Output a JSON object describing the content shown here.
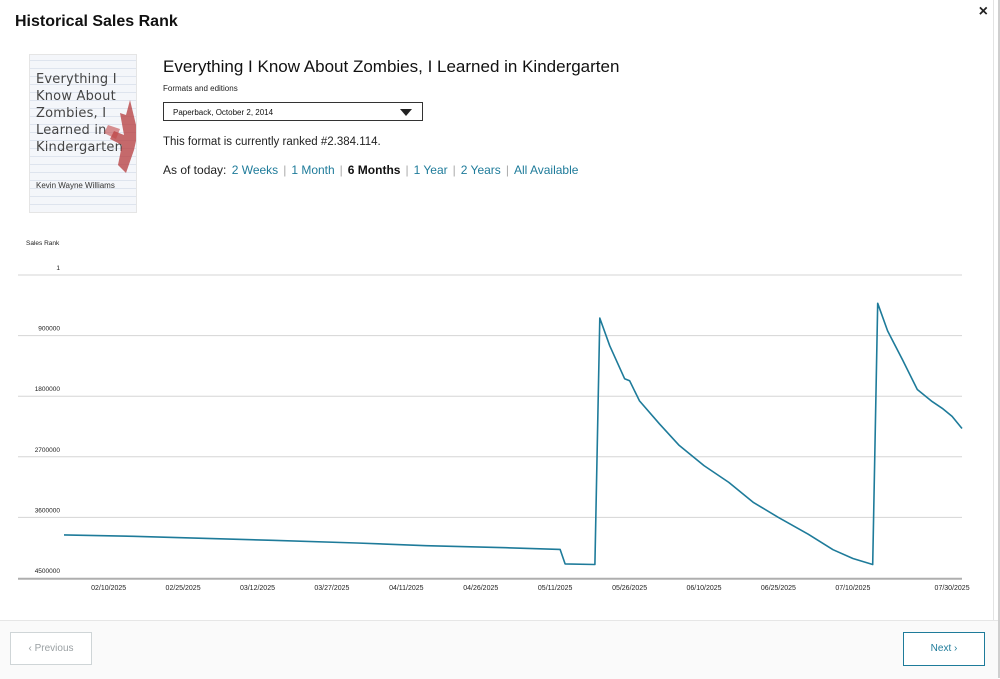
{
  "modal": {
    "title": "Historical Sales Rank",
    "close_label": "×"
  },
  "book": {
    "cover_title": "Everything I Know About Zombies, I Learned in Kindergarten",
    "cover_author": "Kevin Wayne Williams",
    "title": "Everything I Know About Zombies, I Learned in Kindergarten",
    "formats_label": "Formats and editions",
    "selected_format": "Paperback, October 2, 2014",
    "rank_text": "This format is currently ranked #2.384.114."
  },
  "range": {
    "label": "As of today:",
    "options": [
      "2 Weeks",
      "1 Month",
      "6 Months",
      "1 Year",
      "2 Years",
      "All Available"
    ],
    "selected": "6 Months"
  },
  "colors": {
    "line": "#1e7b9a",
    "link": "#1e7b9a"
  },
  "chart_data": {
    "type": "line",
    "ylabel": "Sales Rank",
    "y_axis_inverted": true,
    "ylim": [
      1,
      4500000
    ],
    "y_ticks": [
      1,
      900000,
      1800000,
      2700000,
      3600000,
      4500000
    ],
    "y_tick_labels": [
      "1",
      "900000",
      "1800000",
      "2700000",
      "3600000",
      "4500000"
    ],
    "x_ticks": [
      "2025-02-10",
      "2025-02-25",
      "2025-03-12",
      "2025-03-27",
      "2025-04-11",
      "2025-04-26",
      "2025-05-11",
      "2025-05-26",
      "2025-06-10",
      "2025-06-25",
      "2025-07-10",
      "2025-07-30"
    ],
    "x_tick_labels": [
      "02/10/2025",
      "02/25/2025",
      "03/12/2025",
      "03/27/2025",
      "04/11/2025",
      "04/26/2025",
      "05/11/2025",
      "05/26/2025",
      "06/10/2025",
      "06/25/2025",
      "07/10/2025",
      "07/30/2025"
    ],
    "grid": true,
    "series": [
      {
        "points": [
          [
            "2025-02-01",
            3860000
          ],
          [
            "2025-02-15",
            3880000
          ],
          [
            "2025-03-01",
            3910000
          ],
          [
            "2025-03-15",
            3940000
          ],
          [
            "2025-04-01",
            3980000
          ],
          [
            "2025-04-15",
            4020000
          ],
          [
            "2025-05-01",
            4050000
          ],
          [
            "2025-05-12",
            4075000
          ],
          [
            "2025-05-13",
            4290000
          ],
          [
            "2025-05-19",
            4300000
          ],
          [
            "2025-05-20",
            640000
          ],
          [
            "2025-05-22",
            1050000
          ],
          [
            "2025-05-25",
            1540000
          ],
          [
            "2025-05-26",
            1570000
          ],
          [
            "2025-05-28",
            1870000
          ],
          [
            "2025-06-01",
            2210000
          ],
          [
            "2025-06-05",
            2530000
          ],
          [
            "2025-06-10",
            2830000
          ],
          [
            "2025-06-15",
            3080000
          ],
          [
            "2025-06-20",
            3380000
          ],
          [
            "2025-06-25",
            3600000
          ],
          [
            "2025-07-01",
            3850000
          ],
          [
            "2025-07-06",
            4080000
          ],
          [
            "2025-07-10",
            4210000
          ],
          [
            "2025-07-14",
            4300000
          ],
          [
            "2025-07-15",
            420000
          ],
          [
            "2025-07-17",
            830000
          ],
          [
            "2025-07-20",
            1260000
          ],
          [
            "2025-07-23",
            1700000
          ],
          [
            "2025-07-26",
            1880000
          ],
          [
            "2025-07-28",
            1980000
          ],
          [
            "2025-07-30",
            2100000
          ],
          [
            "2025-08-01",
            2280000
          ]
        ]
      }
    ]
  },
  "footer": {
    "previous_label": "‹  Previous",
    "next_label": "Next ›"
  }
}
